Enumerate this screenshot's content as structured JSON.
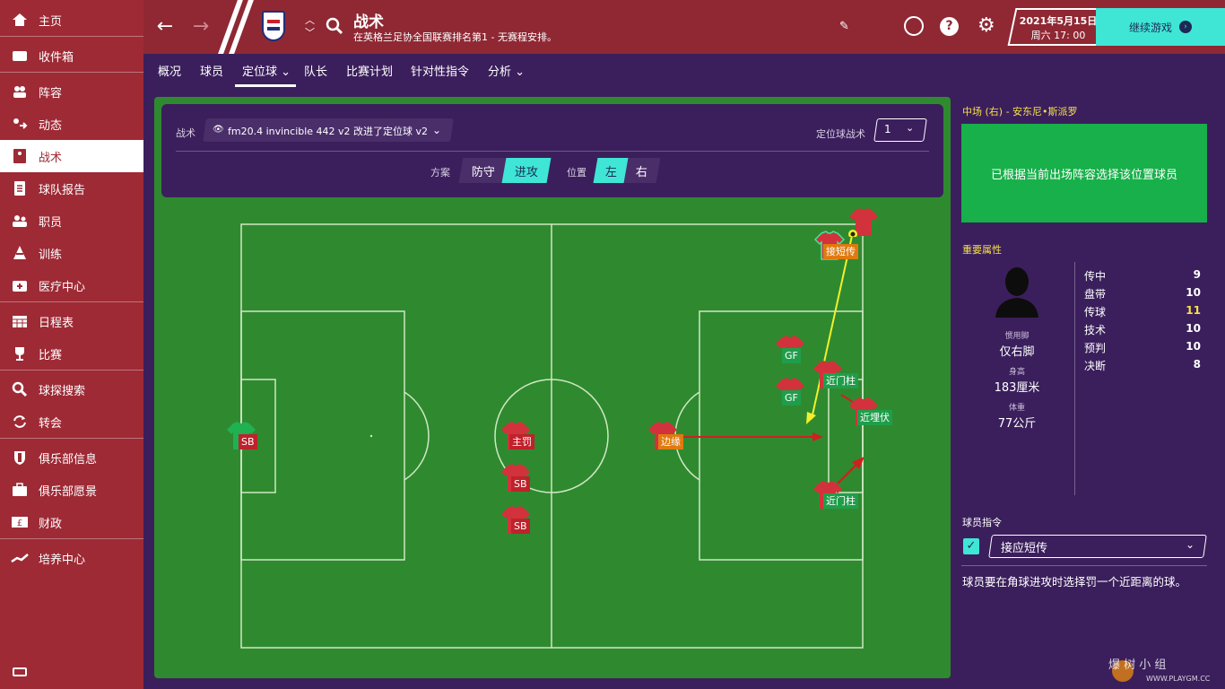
{
  "sidebar": {
    "items": [
      {
        "label": "主页",
        "icon": "home-icon"
      },
      {
        "label": "收件箱",
        "icon": "inbox-icon"
      },
      {
        "label": "阵容",
        "icon": "squad-icon"
      },
      {
        "label": "动态",
        "icon": "dynamics-icon"
      },
      {
        "label": "战术",
        "icon": "tactics-icon"
      },
      {
        "label": "球队报告",
        "icon": "report-icon"
      },
      {
        "label": "职员",
        "icon": "staff-icon"
      },
      {
        "label": "训练",
        "icon": "training-icon"
      },
      {
        "label": "医疗中心",
        "icon": "medical-icon"
      },
      {
        "label": "日程表",
        "icon": "calendar-icon"
      },
      {
        "label": "比赛",
        "icon": "trophy-icon"
      },
      {
        "label": "球探搜索",
        "icon": "search-icon"
      },
      {
        "label": "转会",
        "icon": "transfer-icon"
      },
      {
        "label": "俱乐部信息",
        "icon": "shield-icon"
      },
      {
        "label": "俱乐部愿景",
        "icon": "briefcase-icon"
      },
      {
        "label": "财政",
        "icon": "finance-icon"
      },
      {
        "label": "培养中心",
        "icon": "development-icon"
      }
    ],
    "active_index": 4
  },
  "header": {
    "title": "战术",
    "subtitle": "在英格兰足协全国联赛排名第1 - 无赛程安排。",
    "date": "2021年5月15日",
    "time": "周六 17: 00",
    "continue_label": "继续游戏"
  },
  "tabs": [
    {
      "label": "概况"
    },
    {
      "label": "球员"
    },
    {
      "label": "定位球 ⌄",
      "active": true
    },
    {
      "label": "队长"
    },
    {
      "label": "比赛计划"
    },
    {
      "label": "针对性指令"
    },
    {
      "label": "分析 ⌄"
    }
  ],
  "controls": {
    "tactic_label": "战术",
    "tactic_name": "fm20.4 invincible 442 v2 改进了定位球 v2",
    "set_piece_label": "定位球战术",
    "set_piece_value": "1",
    "scheme_label": "方案",
    "scheme_options": [
      "防守",
      "进攻"
    ],
    "scheme_selected": "进攻",
    "position_label": "位置",
    "position_options": [
      "左",
      "右"
    ],
    "position_selected": "左"
  },
  "players": [
    {
      "tag": "SB",
      "tag_color": "red",
      "shirt": "green",
      "mark": "门将"
    },
    {
      "tag": "主罚",
      "tag_color": "red",
      "shirt": "red",
      "mark": "中"
    },
    {
      "tag": "SB",
      "tag_color": "red",
      "shirt": "red",
      "mark": "后"
    },
    {
      "tag": "SB",
      "tag_color": "red",
      "shirt": "red",
      "mark": "后"
    },
    {
      "tag": "边缘",
      "tag_color": "orange",
      "shirt": "red",
      "mark": "中"
    },
    {
      "tag": "GF",
      "tag_color": "green",
      "shirt": "red",
      "mark": "中"
    },
    {
      "tag": "GF",
      "tag_color": "green",
      "shirt": "red",
      "mark": "前"
    },
    {
      "tag": "近门柱",
      "tag_color": "green",
      "shirt": "red",
      "mark": "前"
    },
    {
      "tag": "近埋伏",
      "tag_color": "green",
      "shirt": "red",
      "mark": "后"
    },
    {
      "tag": "近门柱",
      "tag_color": "green",
      "shirt": "red",
      "mark": "后"
    },
    {
      "tag": "接短传",
      "tag_color": "orange",
      "shirt": "red",
      "mark": "中"
    },
    {
      "tag": "",
      "tag_color": "none",
      "shirt": "red",
      "mark": ""
    }
  ],
  "selected_player": {
    "position_title": "中场 (右) - 安东尼•斯派罗",
    "auto_text": "已根据当前出场阵容选择该位置球员",
    "attributes_title": "重要属性",
    "foot_label": "惯用脚",
    "foot_value": "仅右脚",
    "height_label": "身高",
    "height_value": "183厘米",
    "weight_label": "体重",
    "weight_value": "77公斤",
    "attributes": [
      {
        "name": "传中",
        "value": "9"
      },
      {
        "name": "盘带",
        "value": "10"
      },
      {
        "name": "传球",
        "value": "11",
        "highlight": true
      },
      {
        "name": "技术",
        "value": "10"
      },
      {
        "name": "预判",
        "value": "10"
      },
      {
        "name": "决断",
        "value": "8"
      }
    ]
  },
  "instructions": {
    "title": "球员指令",
    "selected": "接应短传",
    "description": "球员要在角球进攻时选择罚一个近距离的球。"
  },
  "watermark": {
    "text": "爆 树 小 组",
    "sub": "WWW.PLAYGM.CC"
  },
  "colors": {
    "accent": "#3fe6d5",
    "brand": "#9e2a35",
    "panel": "#3b1f5c",
    "pitch": "#2f8a2f"
  }
}
